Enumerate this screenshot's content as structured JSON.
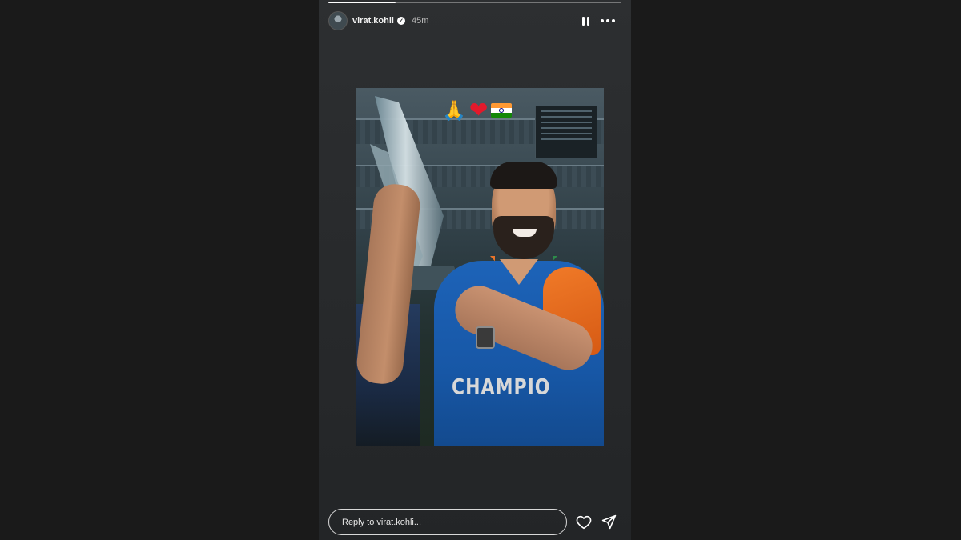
{
  "story": {
    "progress": 0.23,
    "username": "virat.kohli",
    "verified": true,
    "time": "45m"
  },
  "media": {
    "emojis": [
      "🙏",
      "❤",
      "india-flag"
    ],
    "jersey_text": "CHAMPIO"
  },
  "reply": {
    "placeholder": "Reply to virat.kohli..."
  },
  "icons": {
    "pause": "pause-icon",
    "more": "more-icon",
    "like": "heart-icon",
    "share": "send-icon",
    "verified": "verified-badge-icon"
  },
  "colors": {
    "background": "#1a1a1a",
    "panel": "#2d2f31",
    "text": "#f2f2f2",
    "jersey_blue": "#1d63b8",
    "jersey_orange": "#f07a28"
  }
}
